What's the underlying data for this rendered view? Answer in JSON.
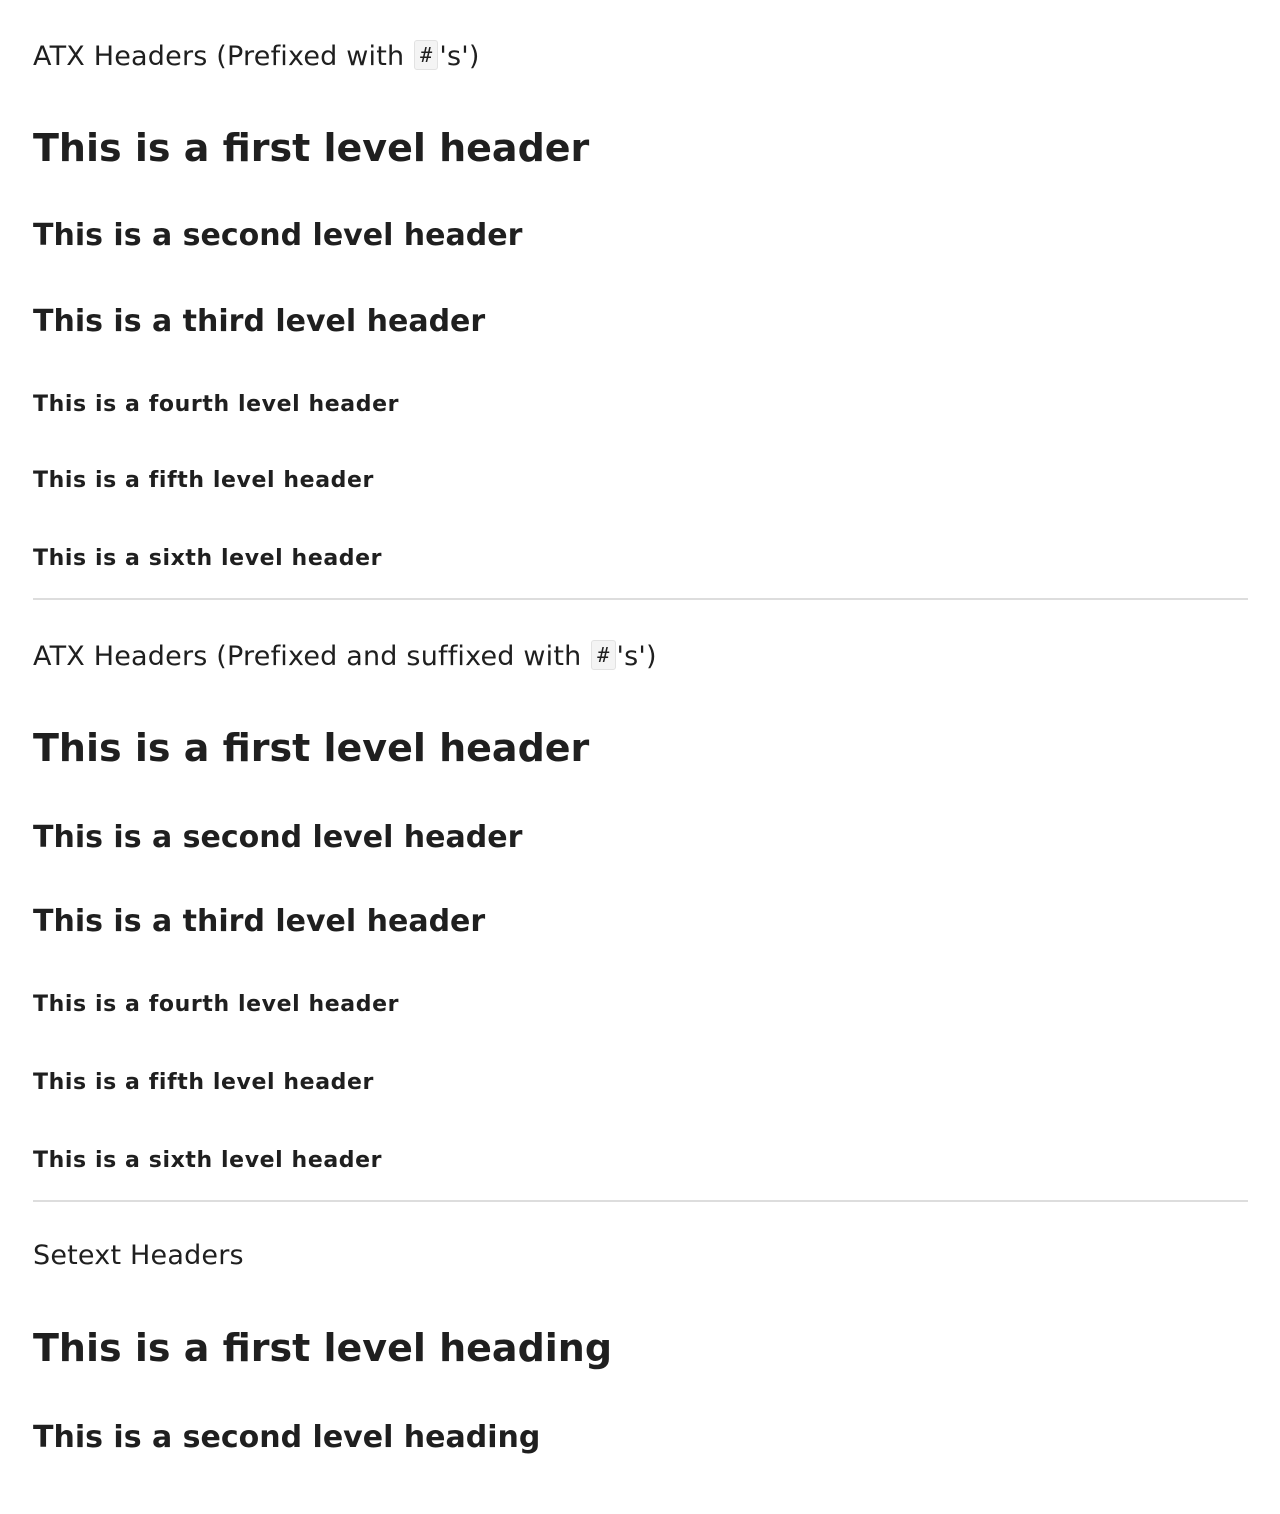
{
  "section1": {
    "label_before": "ATX Headers (Prefixed with ",
    "code": "#",
    "label_after": "'s')",
    "headers": [
      "This is a first level header",
      "This is a second level header",
      "This is a third level header",
      "This is a fourth level header",
      "This is a fifth level header",
      "This is a sixth level header"
    ]
  },
  "section2": {
    "label_before": "ATX Headers (Prefixed and suffixed with ",
    "code": "#",
    "label_after": "'s')",
    "headers": [
      "This is a first level header",
      "This is a second level header",
      "This is a third level header",
      "This is a fourth level header",
      "This is a fifth level header",
      "This is a sixth level header"
    ]
  },
  "section3": {
    "label": "Setext Headers",
    "headings": [
      "This is a first level heading",
      "This is a second level heading"
    ]
  }
}
